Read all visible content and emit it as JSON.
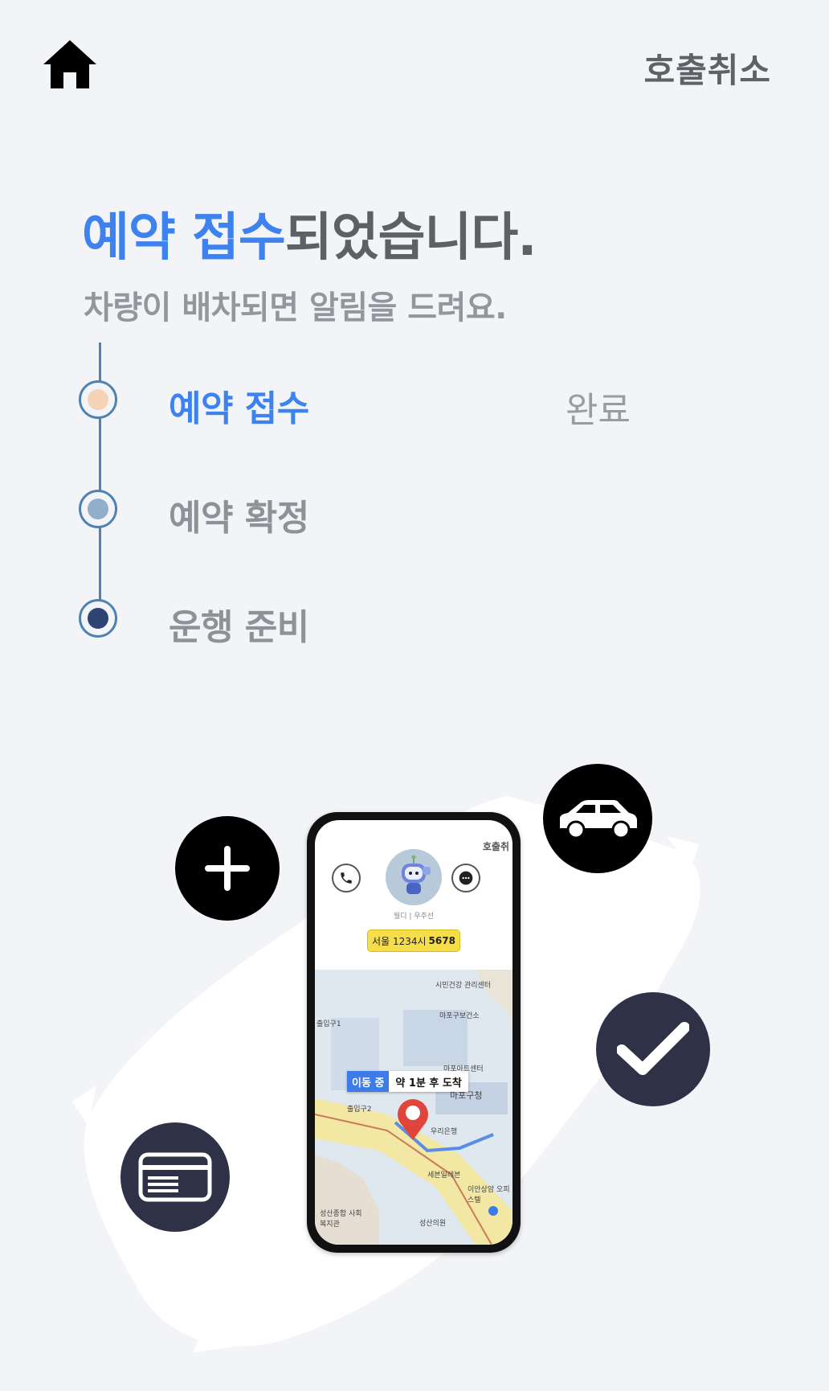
{
  "header": {
    "home_icon": "home-icon",
    "cancel_label": "호출취소"
  },
  "title": {
    "highlight": "예약 접수",
    "rest": "되었습니다.",
    "subtitle": "차량이 배차되면 알림을 드려요."
  },
  "timeline": {
    "steps": [
      {
        "label": "예약 접수",
        "status": "완료",
        "active": true,
        "dot_color": "#f6d3b6"
      },
      {
        "label": "예약 확정",
        "status": "",
        "active": false,
        "dot_color": "#91afca"
      },
      {
        "label": "운행 준비",
        "status": "",
        "active": false,
        "dot_color": "#2f4472"
      }
    ],
    "line_color": "#4f82b1",
    "accent_color": "#3d82ef"
  },
  "illustration": {
    "icons": [
      "plus-icon",
      "car-icon",
      "check-icon",
      "credit-card-icon"
    ],
    "phone": {
      "cancel_label": "호출취",
      "driver": "월디 | 우주선",
      "plate_prefix": "서울 1234시",
      "plate_number": "5678",
      "map_status": "이동 중",
      "map_eta": "약 1분 후 도착",
      "map_labels": [
        "시민건강 관리센터",
        "마포구보건소",
        "출입구1",
        "마포아트센터",
        "마포구청",
        "출입구2",
        "우리은행",
        "세븐일레븐",
        "이안상암 오피스텔",
        "성산종합 사회복지관",
        "성산의원"
      ]
    }
  }
}
